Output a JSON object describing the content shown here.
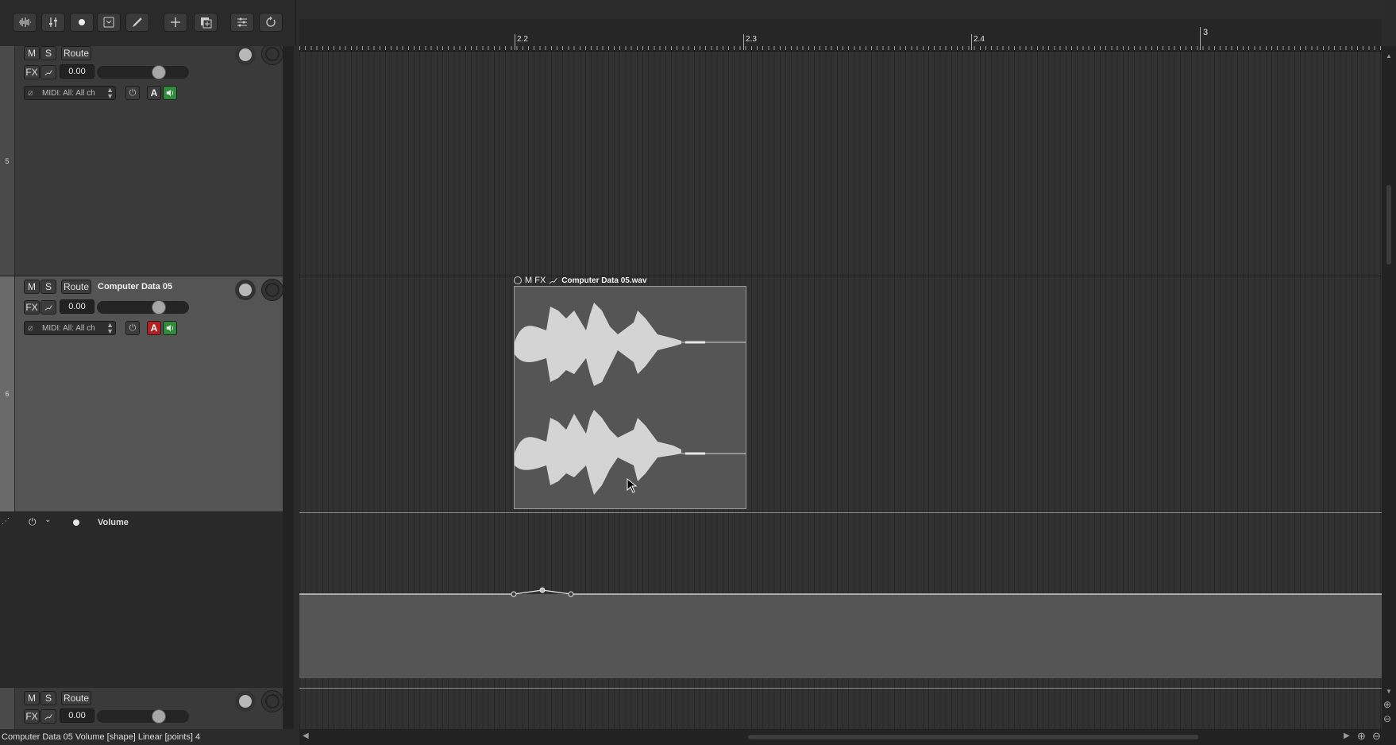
{
  "toolbar": {
    "buttons": [
      {
        "name": "waveform-icon"
      },
      {
        "name": "mixer-icon"
      },
      {
        "name": "record-icon"
      },
      {
        "name": "metronome-icon"
      },
      {
        "name": "pencil-icon"
      },
      {
        "name": "add-track-icon"
      },
      {
        "name": "duplicate-icon"
      },
      {
        "name": "tempo-list-icon"
      },
      {
        "name": "loop-icon"
      }
    ]
  },
  "ruler": {
    "labels": [
      "2.2",
      "2.3",
      "2.4",
      "3"
    ]
  },
  "tracks": [
    {
      "number": "5",
      "name": "",
      "mute_label": "M",
      "solo_label": "S",
      "route_label": "Route",
      "fx_label": "FX",
      "volume": "0.00",
      "midi_label": "MIDI: All: All ch",
      "auto_label": "A",
      "selected": false
    },
    {
      "number": "6",
      "name": "Computer Data 05",
      "mute_label": "M",
      "solo_label": "S",
      "route_label": "Route",
      "fx_label": "FX",
      "volume": "0.00",
      "midi_label": "MIDI: All: All ch",
      "auto_label": "A",
      "selected": true
    },
    {
      "number": "",
      "name": "",
      "mute_label": "M",
      "solo_label": "S",
      "route_label": "Route",
      "fx_label": "FX",
      "volume": "0.00",
      "selected": false
    }
  ],
  "envelope_lane": {
    "label": "Volume"
  },
  "item": {
    "header_prefix": "M FX",
    "name": "Computer Data 05.wav"
  },
  "status_bar": {
    "text": "Computer Data 05 Volume [shape] Linear [points] 4"
  },
  "colors": {
    "auto_active": "#b22222",
    "speaker_on": "#2f8a3c"
  }
}
